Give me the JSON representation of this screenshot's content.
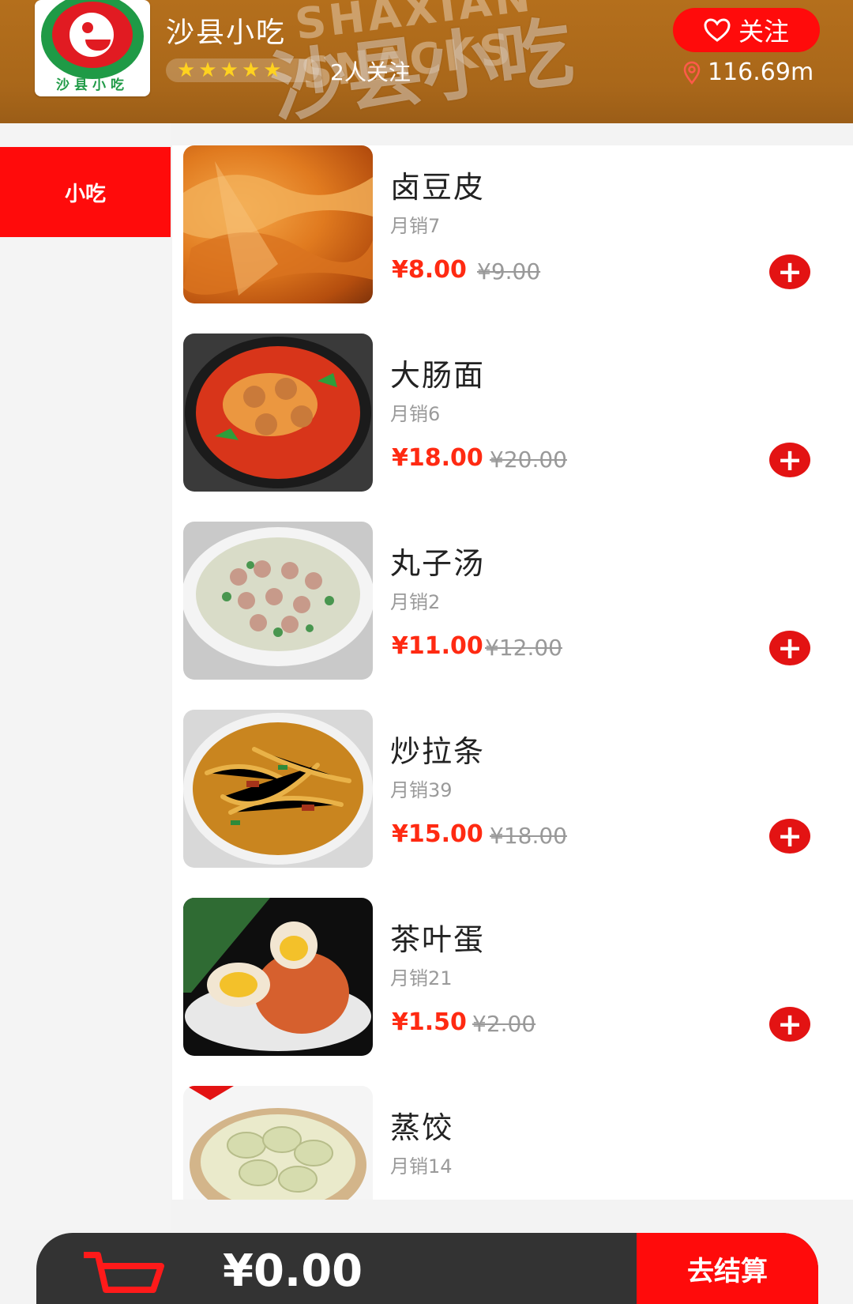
{
  "header": {
    "store_name": "沙县小吃",
    "banner_en": "SHAXIAN SNACKS",
    "banner_zh": "沙县小吃",
    "logo_text": "沙县小吃",
    "followers": "2人关注",
    "follow_label": "关注",
    "distance": "116.69m",
    "rating": 5
  },
  "sidebar": {
    "categories": [
      {
        "label": "小吃",
        "selected": true
      }
    ]
  },
  "products": [
    {
      "name": "卤豆皮",
      "sales": "月销7",
      "price": "¥8.00",
      "original_price": "¥9.00"
    },
    {
      "name": "大肠面",
      "sales": "月销6",
      "price": "¥18.00",
      "original_price": "¥20.00"
    },
    {
      "name": "丸子汤",
      "sales": "月销2",
      "price": "¥11.00",
      "original_price": "¥12.00"
    },
    {
      "name": "炒拉条",
      "sales": "月销39",
      "price": "¥15.00",
      "original_price": "¥18.00"
    },
    {
      "name": "茶叶蛋",
      "sales": "月销21",
      "price": "¥1.50",
      "original_price": "¥2.00"
    },
    {
      "name": "蒸饺",
      "sales": "月销14",
      "price": "",
      "original_price": ""
    }
  ],
  "cart": {
    "total": "¥0.00",
    "checkout_label": "去结算"
  },
  "colors": {
    "accent": "#ff0b0b",
    "header_bg": "#b06b1b",
    "price": "#ff2a12",
    "cart_bar": "#333333"
  }
}
